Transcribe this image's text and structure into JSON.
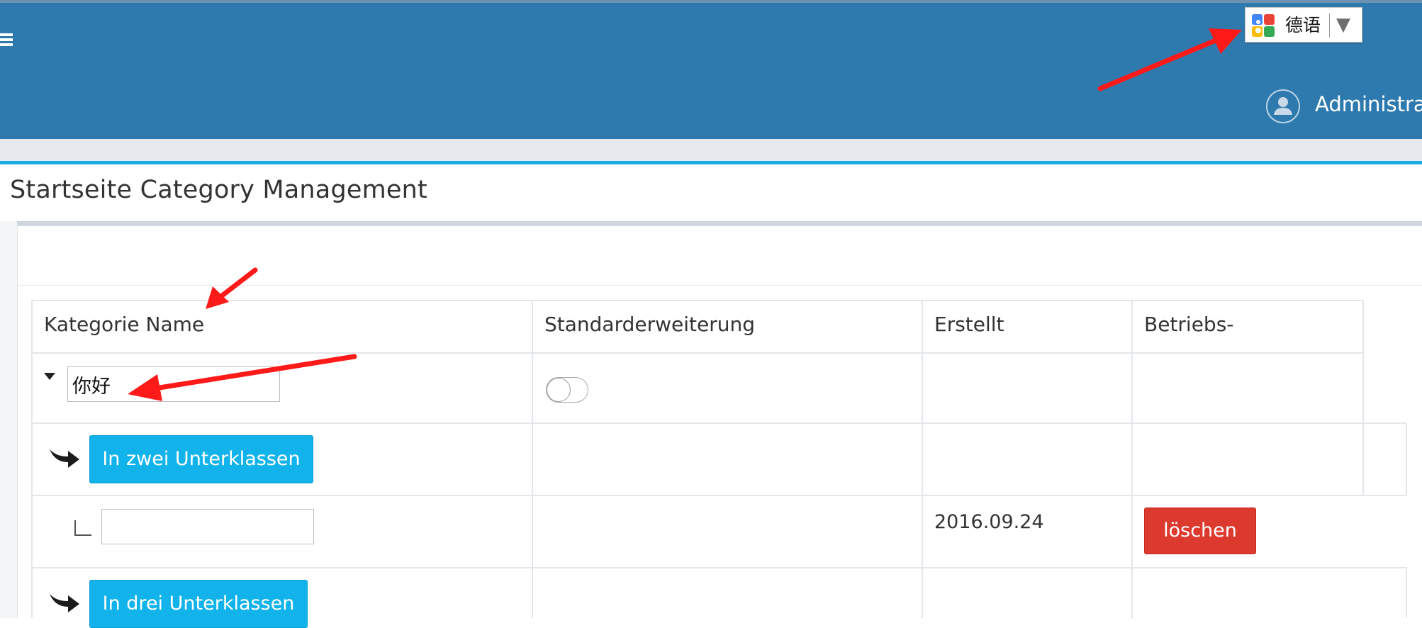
{
  "header": {
    "translate_widget": {
      "language": "德语",
      "dropdown_arrow": "▼",
      "logo_icon": "google-logo-icon"
    },
    "user": {
      "name": "Administrat",
      "avatar_icon": "user-avatar-icon"
    },
    "menu_icon": "hamburger-menu-icon"
  },
  "page": {
    "title": "Startseite Category Management"
  },
  "table": {
    "columns": [
      "Kategorie Name",
      "Standarderweiterung",
      "Erstellt",
      "Betriebs-"
    ],
    "rows": {
      "category": {
        "name_value": "你好",
        "toggle_on": false
      },
      "add_two": {
        "button_label": "In zwei Unterklassen"
      },
      "subclass": {
        "name_value": "",
        "created": "2016.09.24",
        "delete_label": "löschen"
      },
      "add_three": {
        "button_label": "In drei Unterklassen"
      }
    }
  },
  "colors": {
    "header_bg": "#2e7aaf",
    "accent": "#19abe2",
    "button_blue": "#12b3ea",
    "button_red": "#dd3a2f",
    "annotation_arrow": "#ff1a1a"
  }
}
